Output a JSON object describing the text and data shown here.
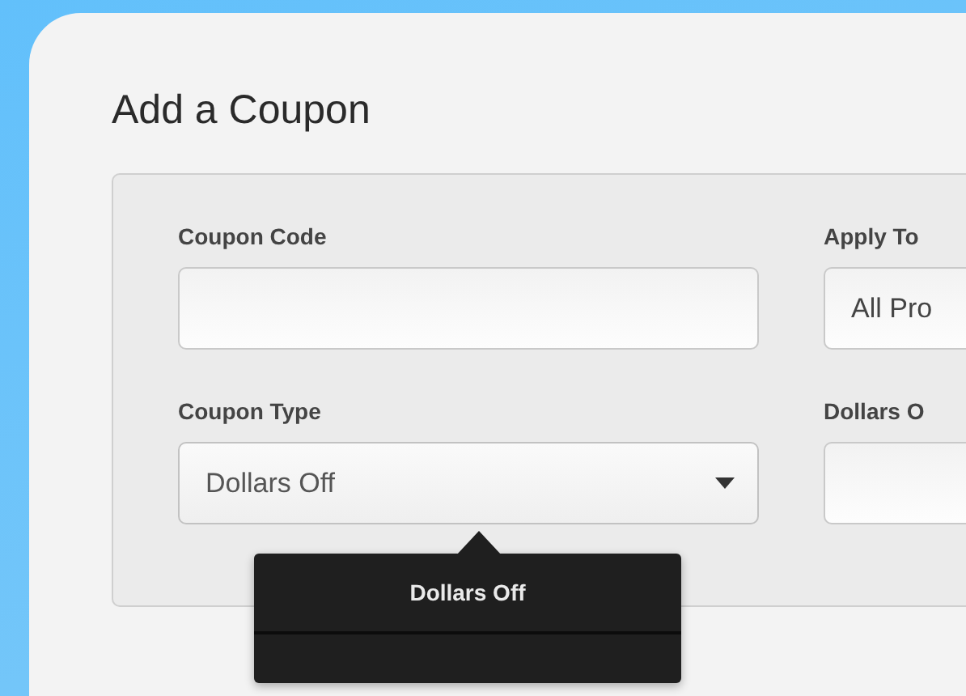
{
  "title": "Add a Coupon",
  "fields": [
    {
      "label": "Coupon Code",
      "kind": "text"
    },
    {
      "label": "Apply To",
      "kind": "text",
      "value": "All Pro"
    },
    {
      "label": "Coupon Type",
      "kind": "select",
      "value": "Dollars Off"
    },
    {
      "label": "Dollars O",
      "kind": "text"
    }
  ],
  "dropdown": {
    "items": [
      {
        "label": "Dollars Off",
        "selected": true
      }
    ]
  }
}
